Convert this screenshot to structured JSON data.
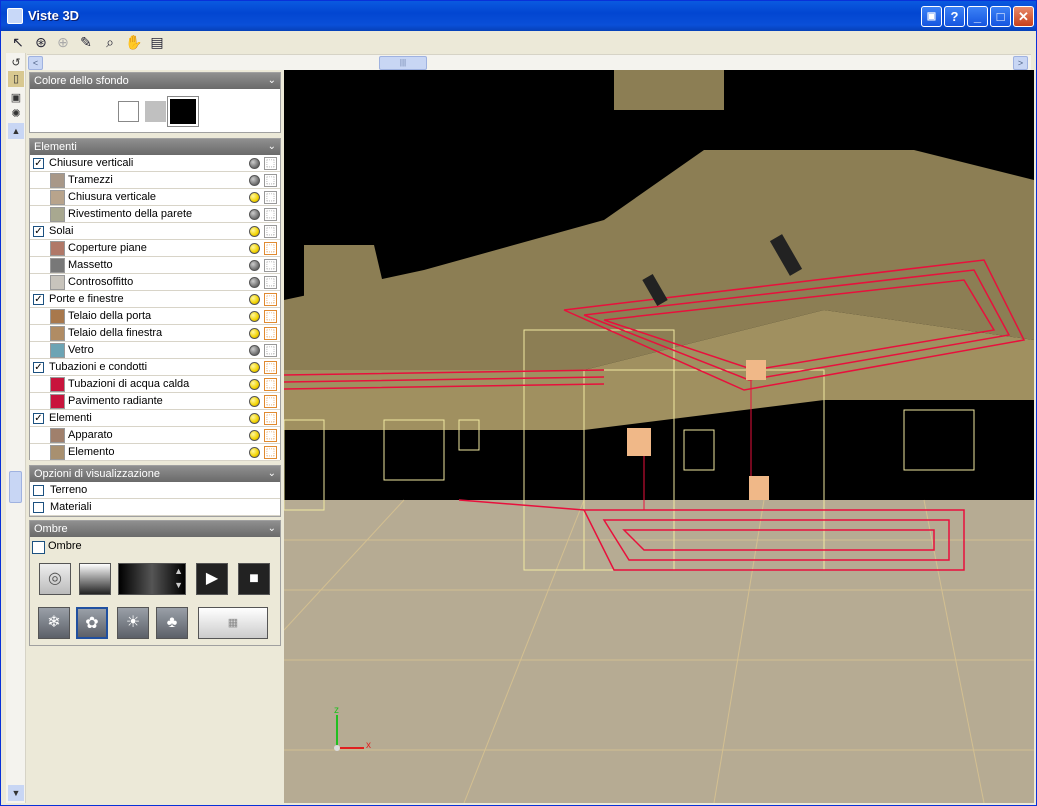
{
  "window": {
    "title": "Viste 3D",
    "buttons": {
      "help": "?",
      "minimize": "_",
      "maximize": "□",
      "close": "✕"
    }
  },
  "toolbar": {
    "icons": [
      "select-arrow-icon",
      "orbit-icon",
      "zoom-extents-icon",
      "draw-icon",
      "zoom-icon",
      "pan-hand-icon",
      "view-settings-icon"
    ]
  },
  "scroll": {
    "thumb_grip": "|||",
    "left": "<",
    "right": ">"
  },
  "background_section": {
    "title": "Colore dello sfondo",
    "colors": [
      "#ffffff",
      "#c0c0c0",
      "#000000"
    ],
    "selected": "#000000"
  },
  "elements_section": {
    "title": "Elementi",
    "rows": [
      {
        "label": "Chiusure verticali",
        "level": 0,
        "checked": true,
        "bulb": "off",
        "cube": false
      },
      {
        "label": "Tramezzi",
        "level": 1,
        "color": "#a89888",
        "bulb": "off",
        "cube": false
      },
      {
        "label": "Chiusura verticale",
        "level": 1,
        "color": "#b8a48c",
        "bulb": "on",
        "cube": false
      },
      {
        "label": "Rivestimento della parete",
        "level": 1,
        "color": "#a8a890",
        "bulb": "off",
        "cube": false
      },
      {
        "label": "Solai",
        "level": 0,
        "checked": true,
        "bulb": "on",
        "cube": false
      },
      {
        "label": "Coperture piane",
        "level": 1,
        "color": "#b07868",
        "bulb": "on",
        "cube": true
      },
      {
        "label": "Massetto",
        "level": 1,
        "color": "#787878",
        "bulb": "off",
        "cube": false
      },
      {
        "label": "Controsoffitto",
        "level": 1,
        "color": "#c8c4bc",
        "bulb": "off",
        "cube": false
      },
      {
        "label": "Porte e finestre",
        "level": 0,
        "checked": true,
        "bulb": "on",
        "cube": true
      },
      {
        "label": "Telaio della porta",
        "level": 1,
        "color": "#a8784c",
        "bulb": "on",
        "cube": true
      },
      {
        "label": "Telaio della finestra",
        "level": 1,
        "color": "#b08c64",
        "bulb": "on",
        "cube": true
      },
      {
        "label": "Vetro",
        "level": 1,
        "color": "#6ca4b4",
        "bulb": "off",
        "cube": false
      },
      {
        "label": "Tubazioni e condotti",
        "level": 0,
        "checked": true,
        "bulb": "on",
        "cube": true
      },
      {
        "label": "Tubazioni di acqua calda",
        "level": 1,
        "color": "#c8143c",
        "bulb": "on",
        "cube": true
      },
      {
        "label": "Pavimento radiante",
        "level": 1,
        "color": "#c8143c",
        "bulb": "on",
        "cube": true
      },
      {
        "label": "Elementi",
        "level": 0,
        "checked": true,
        "bulb": "on",
        "cube": true
      },
      {
        "label": "Apparato",
        "level": 1,
        "color": "#a0806c",
        "bulb": "on",
        "cube": true
      },
      {
        "label": "Elemento",
        "level": 1,
        "color": "#a89070",
        "bulb": "on",
        "cube": true
      }
    ]
  },
  "display_section": {
    "title": "Opzioni di visualizzazione",
    "options": [
      {
        "label": "Terreno",
        "checked": false
      },
      {
        "label": "Materiali",
        "checked": false
      }
    ]
  },
  "shadows_section": {
    "title": "Ombre",
    "checkbox_label": "Ombre",
    "checked": false,
    "season_icons": [
      "winter-snowflake-icon",
      "spring-flower-icon",
      "summer-sun-icon",
      "autumn-leaf-icon"
    ]
  },
  "viewport": {
    "axis_x": "x",
    "axis_z": "z"
  },
  "colors": {
    "accent": "#0a5ae0",
    "pipe_red": "#e8103c",
    "wall_beige": "#8c7e54"
  }
}
